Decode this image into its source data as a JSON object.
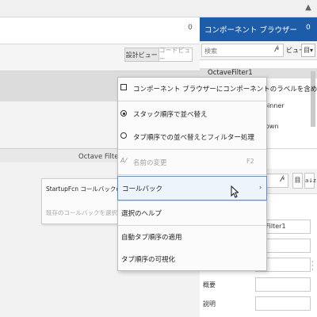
{
  "top": {
    "chevron": "▲"
  },
  "designer": {
    "pin_glyph": "0",
    "view_toggle": {
      "design": "設計ビュー",
      "code": "コードビュー"
    },
    "app_title": "Octave Filter"
  },
  "left_menu": {
    "items": [
      "StartupFcn コールバックの追加",
      "既存のコールバックを選択..."
    ]
  },
  "component_browser": {
    "title": "コンポーネント ブラウザー",
    "pin_glyph": "0",
    "search_placeholder": "検索",
    "view_label": "ビュー",
    "view_button": "目▾",
    "tree": {
      "root": "OctaveFilter1",
      "items": [
        "pinner",
        "own"
      ]
    }
  },
  "inspector": {
    "sort_button": "目",
    "az_button": "a↓z",
    "properties": {
      "values": [
        "veFilter1",
        "",
        "",
        "",
        ""
      ],
      "labels": [
        "概要",
        "説明"
      ]
    }
  },
  "context_menu": {
    "items": [
      {
        "label": "コンポーネント ブラウザーにコンポーネントのラベルを含める",
        "type": "checkbox",
        "checked": false
      },
      {
        "label": "スタック順序で並べ替え",
        "type": "radio",
        "selected": true
      },
      {
        "label": "タブ順序での並べ替えとフィルター処理",
        "type": "radio",
        "selected": false
      },
      {
        "label": "名前の変更",
        "type": "command",
        "enabled": false,
        "shortcut": "F2"
      },
      {
        "label": "コールバック",
        "type": "submenu",
        "highlighted": true
      },
      {
        "label": "選択のヘルプ",
        "type": "command"
      },
      {
        "label": "自動タブ順序の適用",
        "type": "command"
      },
      {
        "label": "タブ順序の可視化",
        "type": "command"
      }
    ],
    "submenu_arrow": "›"
  },
  "colors": {
    "panel_header": "#1d5ca8",
    "menu_highlight_border": "#5b8fd6"
  }
}
